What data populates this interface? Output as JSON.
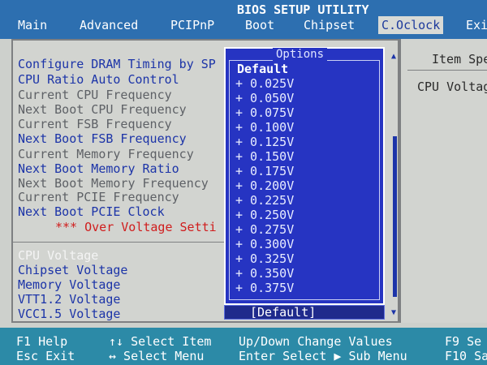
{
  "bios_title": "BIOS SETUP UTILITY",
  "menu": [
    {
      "label": "Main"
    },
    {
      "label": "Advanced"
    },
    {
      "label": "PCIPnP"
    },
    {
      "label": "Boot"
    },
    {
      "label": "Chipset"
    },
    {
      "label": "C.Oclock",
      "active": true
    },
    {
      "label": "Exi"
    }
  ],
  "items": [
    {
      "label": "Configure DRAM Timing by SP",
      "type": "selectable"
    },
    {
      "label": "CPU Ratio Auto Control",
      "type": "selectable"
    },
    {
      "label": "Current CPU Frequency",
      "type": "readonly"
    },
    {
      "label": "Next Boot CPU Frequency",
      "type": "readonly"
    },
    {
      "label": "Current FSB Frequency",
      "type": "readonly"
    },
    {
      "label": "Next Boot FSB Frequency",
      "type": "selectable"
    },
    {
      "label": "Current Memory Frequency",
      "type": "readonly"
    },
    {
      "label": "Next Boot Memory Ratio",
      "type": "selectable"
    },
    {
      "label": "Next Boot Memory Frequency",
      "type": "readonly"
    },
    {
      "label": "Current PCIE Frequency",
      "type": "readonly"
    },
    {
      "label": "Next Boot PCIE Clock",
      "type": "selectable"
    },
    {
      "label": "*** Over Voltage Setti",
      "type": "warning"
    },
    {
      "label": "CPU Voltage",
      "type": "highlight"
    },
    {
      "label": "Chipset Voltage",
      "type": "selectable"
    },
    {
      "label": "Memory Voltage",
      "type": "selectable"
    },
    {
      "label": "VTT1.2 Voltage",
      "type": "selectable"
    },
    {
      "label": "VCC1.5 Voltage",
      "type": "selectable"
    }
  ],
  "help": {
    "title": "Item Spe",
    "text": "CPU Voltage"
  },
  "options": {
    "title": "Options",
    "default": "Default",
    "values": [
      "+ 0.025V",
      "+ 0.050V",
      "+ 0.075V",
      "+ 0.100V",
      "+ 0.125V",
      "+ 0.150V",
      "+ 0.175V",
      "+ 0.200V",
      "+ 0.225V",
      "+ 0.250V",
      "+ 0.275V",
      "+ 0.300V",
      "+ 0.325V",
      "+ 0.350V",
      "+ 0.375V"
    ],
    "current": "[Default]"
  },
  "keys": [
    {
      "label": "F1  Help"
    },
    {
      "label": "Esc Exit"
    },
    {
      "label": "↑↓ Select Item"
    },
    {
      "label": "↔ Select Menu"
    },
    {
      "label": "Up/Down Change Values"
    },
    {
      "label": "Enter  Select ▶ Sub Menu"
    },
    {
      "label": "F9  Se"
    },
    {
      "label": "F10 Sa"
    }
  ]
}
